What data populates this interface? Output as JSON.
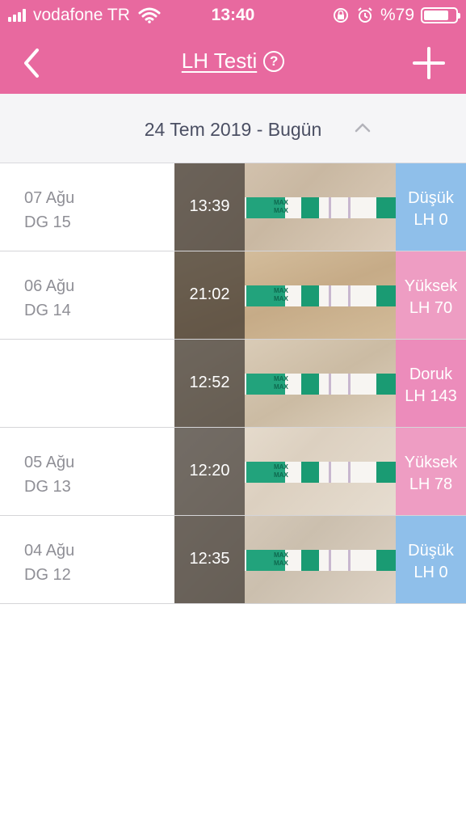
{
  "status_bar": {
    "carrier": "vodafone TR",
    "time": "13:40",
    "battery": "%79",
    "battery_level": 0.79
  },
  "nav": {
    "title": "LH Testi",
    "help_symbol": "?"
  },
  "date_range": "24 Tem 2019 - Bugün",
  "colors": {
    "header": "#e8699f",
    "low": "#8fbfea",
    "high": "#ee9dc3",
    "peak": "#ec8cbb"
  },
  "days": [
    {
      "date": "07 Ağu",
      "cycle_day": "DG 15",
      "tests": [
        {
          "time": "13:39",
          "result": "Düşük",
          "value": "LH 0",
          "level": "low"
        }
      ]
    },
    {
      "date": "06 Ağu",
      "cycle_day": "DG 14",
      "tests": [
        {
          "time": "21:02",
          "result": "Yüksek",
          "value": "LH 70",
          "level": "high"
        },
        {
          "time": "12:52",
          "result": "Doruk",
          "value": "LH 143",
          "level": "peak"
        }
      ]
    },
    {
      "date": "05 Ağu",
      "cycle_day": "DG 13",
      "tests": [
        {
          "time": "12:20",
          "result": "Yüksek",
          "value": "LH 78",
          "level": "high"
        }
      ]
    },
    {
      "date": "04 Ağu",
      "cycle_day": "DG 12",
      "tests": [
        {
          "time": "12:35",
          "result": "Düşük",
          "value": "LH 0",
          "level": "low"
        }
      ]
    }
  ]
}
